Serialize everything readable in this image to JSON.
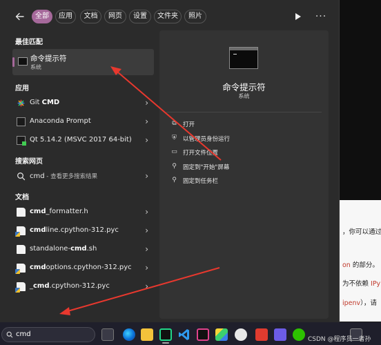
{
  "filters": {
    "back_icon": "arrow-left-icon",
    "chips": [
      "全部",
      "应用",
      "文档",
      "网页",
      "设置",
      "文件夹",
      "照片"
    ],
    "active_index": 0,
    "play_icon": "play-icon",
    "more_icon": "ellipsis-icon",
    "accent": "#a6699b"
  },
  "sections": {
    "best": "最佳匹配",
    "apps": "应用",
    "web": "搜索网页",
    "docs": "文档"
  },
  "best_match": {
    "title": "命令提示符",
    "subtitle": "系统",
    "icon": "terminal-icon"
  },
  "apps": [
    {
      "pre": "Git ",
      "bold": "CMD",
      "post": "",
      "icon": "git-icon"
    },
    {
      "pre": "Anaconda Prompt",
      "bold": "",
      "post": "",
      "icon": "terminal-icon"
    },
    {
      "pre": "Qt 5.14.2 (MSVC 2017 64-bit)",
      "bold": "",
      "post": "",
      "icon": "qt-icon"
    }
  ],
  "web_search": {
    "query": "cmd",
    "suffix": " - 查看更多搜索结果",
    "icon": "search-icon"
  },
  "docs": [
    {
      "pre": "",
      "bold": "cmd",
      "post": "_formatter.h",
      "icon": "file-icon"
    },
    {
      "pre": "",
      "bold": "cmd",
      "post": "line.cpython-312.pyc",
      "icon": "python-file-icon"
    },
    {
      "pre": "standalone-",
      "bold": "cmd",
      "post": ".sh",
      "icon": "file-icon"
    },
    {
      "pre": "",
      "bold": "cmd",
      "post": "options.cpython-312.pyc",
      "icon": "python-file-icon"
    },
    {
      "pre": "_",
      "bold": "cmd",
      "post": ".cpython-312.pyc",
      "icon": "python-file-icon"
    }
  ],
  "preview": {
    "title": "命令提示符",
    "subtitle": "系统",
    "actions": [
      {
        "label": "打开",
        "icon": "open-icon"
      },
      {
        "label": "以管理员身份运行",
        "icon": "shield-icon"
      },
      {
        "label": "打开文件位置",
        "icon": "folder-icon"
      },
      {
        "label": "固定到\"开始\"屏幕",
        "icon": "pin-icon"
      },
      {
        "label": "固定到任务栏",
        "icon": "pin-icon"
      }
    ]
  },
  "background_doc": {
    "line1": "，你可以通过",
    "line2_red": "on",
    "line2": " 的部分。",
    "line3": "为不依赖 ",
    "line3_red": "IPy",
    "line4_red": "ipenv",
    "line4": "），请"
  },
  "taskbar": {
    "search_value": "cmd",
    "search_icon": "search-icon",
    "watermark": "CSDN @程序员一者孙"
  }
}
